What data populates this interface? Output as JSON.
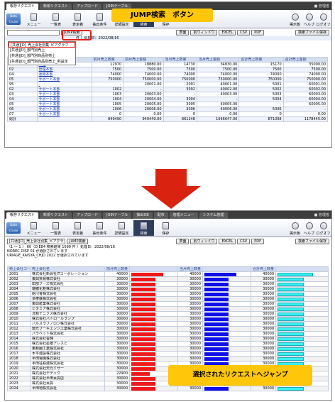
{
  "tabs": [
    "帳存リクエスト",
    "新規リクエスト",
    "アップロード",
    "JOINテーブル",
    "抽出DB",
    "配布",
    "管理メニュー",
    "システム管理"
  ],
  "admin": "■ 管理者",
  "toolbar": {
    "logo": "Data Cruise",
    "buttons": [
      "メニュー",
      "一覧表",
      "表定義",
      "抽出条件",
      "詳細設定",
      "検索",
      "保存"
    ],
    "right_buttons": [
      "掲示板",
      "ヘルプ",
      "ログオフ"
    ]
  },
  "callout_top": "JUMP検索　ボタン",
  "callout_bottom": "選択されたリクエストへジャンプ",
  "top": {
    "select_value": "",
    "jump_button": "JUMP検索",
    "action_buttons": [
      "表面",
      "別ウィンドウ",
      "EXCEL",
      "CSV",
      "PDF"
    ],
    "save_file_button": "検索ファイル保存",
    "dropdown": [
      "[共通][D]_売上会社別集_ピアグラフ",
      "[共通][D]_部門別売上",
      "[共通][D]_部門別商品別売上",
      "[共通][D]_部門別商品別売上_利益定"
    ],
    "info": "件 ）処理日：2022/08/16",
    "columns": [
      "",
      "",
      "前月売上数量",
      "前月売上金額",
      "当月売上数量",
      "当月売上金額",
      "合計売上数量",
      "合計売上金額"
    ],
    "rows": [
      [
        "01",
        "本社",
        {
          "q1": "12970",
          "a1": "18880.00",
          "q2": "14730",
          "a2": "34830.00",
          "q3": "15170",
          "a3": "35000.00"
        }
      ],
      [
        "02",
        "管理本部",
        {
          "q1": "7500",
          "a1": "7500.00",
          "q2": "7500",
          "a2": "7500.00",
          "q3": "7500",
          "a3": "7500.00"
        }
      ],
      [
        "04",
        "運用本部",
        {
          "q1": "74000",
          "a1": "74000.00",
          "q2": "74000",
          "a2": "74000.00",
          "q3": "74000",
          "a3": "74000.00"
        }
      ],
      [
        "05",
        "サポート本部",
        {
          "q1": "750000",
          "a1": "750000.00",
          "q2": "750000",
          "a2": "750000.00",
          "q3": "750000",
          "a3": "750000.00"
        }
      ],
      [
        "95",
        "-",
        {
          "q1": "-",
          "a1": "20001.00",
          "q2": "2001",
          "a2": "40001.00",
          "q3": "5001",
          "a3": "60001.00"
        }
      ],
      [
        "02",
        "サポート本部",
        {
          "q1": "1002",
          "a1": "-",
          "q2": "3002",
          "a2": "40002.00",
          "q3": "5002",
          "a3": "60002.00"
        }
      ],
      [
        "03",
        "サポート本部",
        {
          "q1": "1003",
          "a1": "20003.00",
          "q2": "-",
          "a2": "40003.00",
          "q3": "5003",
          "a3": "60003.00"
        }
      ],
      [
        "04",
        "サポート本部",
        {
          "q1": "1004",
          "a1": "20004.00",
          "q2": "3004",
          "a2": "-",
          "q3": "5004",
          "a3": "60004.00"
        }
      ],
      [
        "05",
        "サポート本部",
        {
          "q1": "1005",
          "a1": "20005.00",
          "q2": "3005",
          "a2": "40005.00",
          "q3": "-",
          "a3": "60005.00"
        }
      ],
      [
        "06",
        "サポート本部",
        {
          "q1": "1006",
          "a1": "20006.00",
          "q2": "3006",
          "a2": "40006.00",
          "q3": "5006",
          "a3": "-"
        }
      ],
      [
        "07",
        "サポート本部",
        {
          "q1": "0",
          "a1": "0.00",
          "q2": "0",
          "a2": "0.00",
          "q3": "0",
          "a3": "0.00"
        }
      ]
    ],
    "total": [
      "総計",
      "",
      "849490",
      "940449.00",
      "861248",
      "1066647.00",
      "871008",
      "1178445.00"
    ]
  },
  "bottom": {
    "select_value": "[共通][D]_売上会社別集_ピアグラ",
    "jump_button": "JUMP検索",
    "action_buttons": [
      "表面",
      "別ウィンドウ",
      "EXCEL",
      "CSV",
      "PDF"
    ],
    "save_file_button": "検索ファイル保存",
    "info_lines": [
      "（1 ～ 1 ） 60（D,E84 検索結果 1099 件 ）処理日：2022/08/16",
      "NOREC DISP 01 が選択されています",
      "URIAGE_KAISYA_CHJO 2022 が選択されています"
    ],
    "columns": [
      "売上会社コード",
      "売上会社名",
      "前月売上数量",
      "",
      "当月売上数量",
      "",
      "合計売上数量",
      ""
    ],
    "max": 40000,
    "rows": [
      {
        "code": "2001",
        "name": "株式会社新会社ITコーポレーション",
        "v1": "40000",
        "v2": "40000",
        "v3": "40000"
      },
      {
        "code": "2002",
        "name": "東興貿易株式会社",
        "v1": "30000",
        "v2": "30000",
        "v3": "30000"
      },
      {
        "code": "2003",
        "name": "田部フーズ株式会社",
        "v1": "30000",
        "v2": "30000",
        "v3": "30000"
      },
      {
        "code": "2004",
        "name": "瑞穂化粧株式会社",
        "v1": "30000",
        "v2": "30000",
        "v3": "30000"
      },
      {
        "code": "2005",
        "name": "館川會株式会社",
        "v1": "30000",
        "v2": "30000",
        "v3": "30000"
      },
      {
        "code": "2006",
        "name": "多摩鉄株式会社",
        "v1": "30000",
        "v2": "30000",
        "v3": "30000"
      },
      {
        "code": "2007",
        "name": "東興産業株式会社",
        "v1": "30000",
        "v2": "30000",
        "v3": "30000"
      },
      {
        "code": "2008",
        "name": "ビタミア株式会社",
        "v1": "30000",
        "v2": "30000",
        "v3": "30000"
      },
      {
        "code": "2009",
        "name": "洸和テニクス株式会社",
        "v1": "30000",
        "v2": "30000",
        "v3": "30000"
      },
      {
        "code": "2010",
        "name": "株式会社バトロールランプ",
        "v1": "30000",
        "v2": "30000",
        "v3": "30000"
      },
      {
        "code": "2011",
        "name": "ハルスラブノロジ株式会社",
        "v1": "30000",
        "v2": "30000",
        "v3": "30000"
      },
      {
        "code": "2012",
        "name": "環光ブーキエンジ工業株式会社",
        "v1": "30000",
        "v2": "30000",
        "v3": "30000"
      },
      {
        "code": "2013",
        "name": "パラベット株式会社",
        "v1": "30000",
        "v2": "30000",
        "v3": "30000"
      },
      {
        "code": "2014",
        "name": "株式会社誓輝",
        "v1": "30000",
        "v2": "30000",
        "v3": "30000"
      },
      {
        "code": "2015",
        "name": "株式会社星橋アレスと",
        "v1": "30000",
        "v2": "30000",
        "v3": "30000"
      },
      {
        "code": "2016",
        "name": "東和圏工業株式会社",
        "v1": "30000",
        "v2": "30000",
        "v3": "30000"
      },
      {
        "code": "2017",
        "name": "木平建設株式会社",
        "v1": "30000",
        "v2": "30000",
        "v3": "30000"
      },
      {
        "code": "2018",
        "name": "半田電機株式会社",
        "v1": "30000",
        "v2": "30000",
        "v3": "30000"
      },
      {
        "code": "2019",
        "name": "半田征鉄建株式会社",
        "v1": "30000",
        "v2": "30000",
        "v3": "30000"
      },
      {
        "code": "2020",
        "name": "株式会社天元ミサー",
        "v1": "30000",
        "v2": "30000",
        "v3": "30000"
      },
      {
        "code": "2021",
        "name": "株式会社デテック",
        "v1": "22900",
        "v2": "22900",
        "v3": "22900"
      },
      {
        "code": "2022",
        "name": "株式会社半田百貨店",
        "v1": "30000",
        "v2": "30000",
        "v3": "30000"
      },
      {
        "code": "2023",
        "name": "株式会社百貨",
        "v1": "30000",
        "v2": "30000",
        "v3": "30000"
      },
      {
        "code": "2024",
        "name": "半田地株式会社",
        "v1": "30000",
        "v2": "30000",
        "v3": "30000"
      }
    ]
  },
  "colors": {
    "bar1": "#f01818",
    "bar2": "#1010e8",
    "bar3": "#38f0f0",
    "highlight": "#e0201c",
    "callout": "#ffc60a",
    "arrow": "#d92310"
  }
}
